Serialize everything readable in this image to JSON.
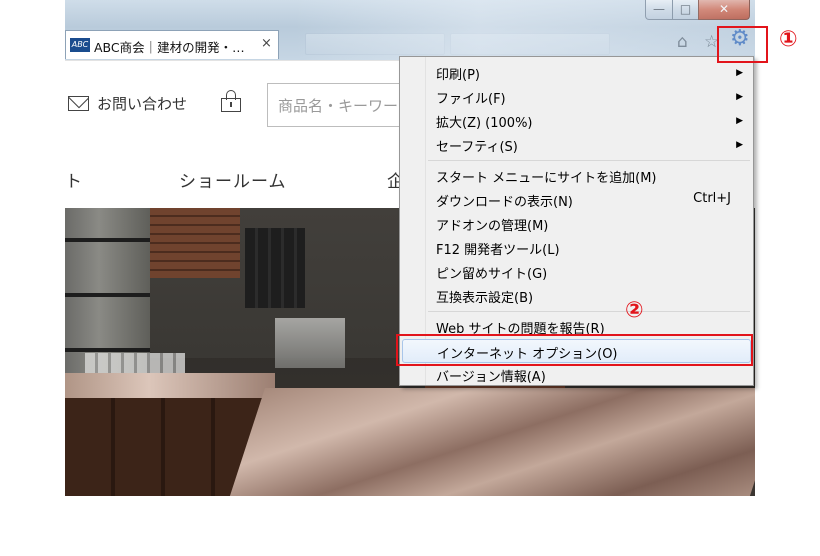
{
  "window": {
    "controls": {
      "minimize": "—",
      "maximize": "□",
      "close": "✕"
    }
  },
  "tab": {
    "favicon_text": "ABC",
    "title": "ABC商会｜建材の開発・…",
    "close": "×"
  },
  "toolbar": {
    "home_icon": "⌂",
    "favorites_icon": "☆",
    "gear_icon": "⚙"
  },
  "page": {
    "contact_label": "お問い合わせ",
    "search_placeholder": "商品名・キーワード",
    "nav": [
      "ト",
      "ショールーム",
      "企"
    ]
  },
  "menu": {
    "groups": [
      [
        {
          "label": "印刷(P)",
          "submenu": true
        },
        {
          "label": "ファイル(F)",
          "submenu": true
        },
        {
          "label": "拡大(Z) (100%)",
          "submenu": true
        },
        {
          "label": "セーフティ(S)",
          "submenu": true
        }
      ],
      [
        {
          "label": "スタート メニューにサイトを追加(M)"
        },
        {
          "label": "ダウンロードの表示(N)",
          "shortcut": "Ctrl+J"
        },
        {
          "label": "アドオンの管理(M)"
        },
        {
          "label": "F12 開発者ツール(L)"
        },
        {
          "label": "ピン留めサイト(G)"
        },
        {
          "label": "互換表示設定(B)"
        }
      ],
      [
        {
          "label": "Web サイトの問題を報告(R)"
        },
        {
          "label": "インターネット オプション(O)"
        },
        {
          "label": "バージョン情報(A)"
        }
      ]
    ],
    "submenu_arrow": "▶"
  },
  "annotations": {
    "callout_1": "①",
    "callout_2": "②",
    "highlight_color": "#e2141b"
  }
}
